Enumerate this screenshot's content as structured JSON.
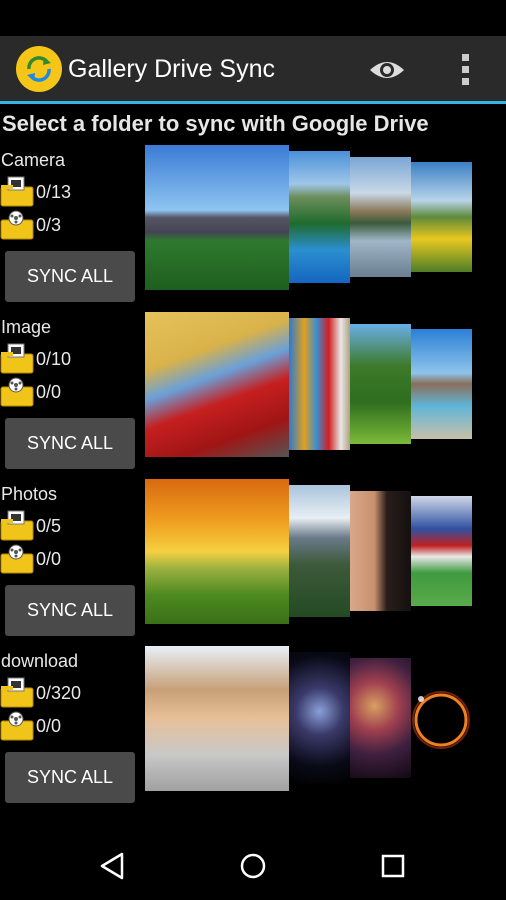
{
  "app": {
    "title": "Gallery Drive Sync",
    "accent": "#33b5e5",
    "logo_color": "#f5c518"
  },
  "header_actions": [
    {
      "icon": "eye-icon"
    },
    {
      "icon": "overflow-menu-icon"
    }
  ],
  "heading": "Select a folder to sync with Google Drive",
  "folders": [
    {
      "name": "Camera",
      "photo_count": "0/13",
      "video_count": "0/3",
      "sync_label": "SYNC ALL",
      "thumbnails": [
        "city-skyline-park",
        "mountain-lake",
        "lake-reflection",
        "yellow-flower-field"
      ]
    },
    {
      "name": "Image",
      "photo_count": "0/10",
      "video_count": "0/0",
      "sync_label": "SYNC ALL",
      "thumbnails": [
        "red-bus-umbrella-statue",
        "colorful-beach-huts",
        "green-trees-meadow",
        "blue-lake-mountains"
      ]
    },
    {
      "name": "Photos",
      "photo_count": "0/5",
      "video_count": "0/0",
      "sync_label": "SYNC ALL",
      "thumbnails": [
        "sunset-meadow-tree",
        "snowy-mountain-forest",
        "woman-portrait",
        "soccer-team"
      ]
    },
    {
      "name": "download",
      "photo_count": "0/320",
      "video_count": "0/0",
      "sync_label": "SYNC ALL",
      "thumbnails": [
        "happy-family",
        "galaxy",
        "nebula",
        "eclipse-ring"
      ]
    }
  ],
  "navbar": [
    {
      "icon": "back-icon"
    },
    {
      "icon": "home-icon"
    },
    {
      "icon": "recents-icon"
    }
  ]
}
